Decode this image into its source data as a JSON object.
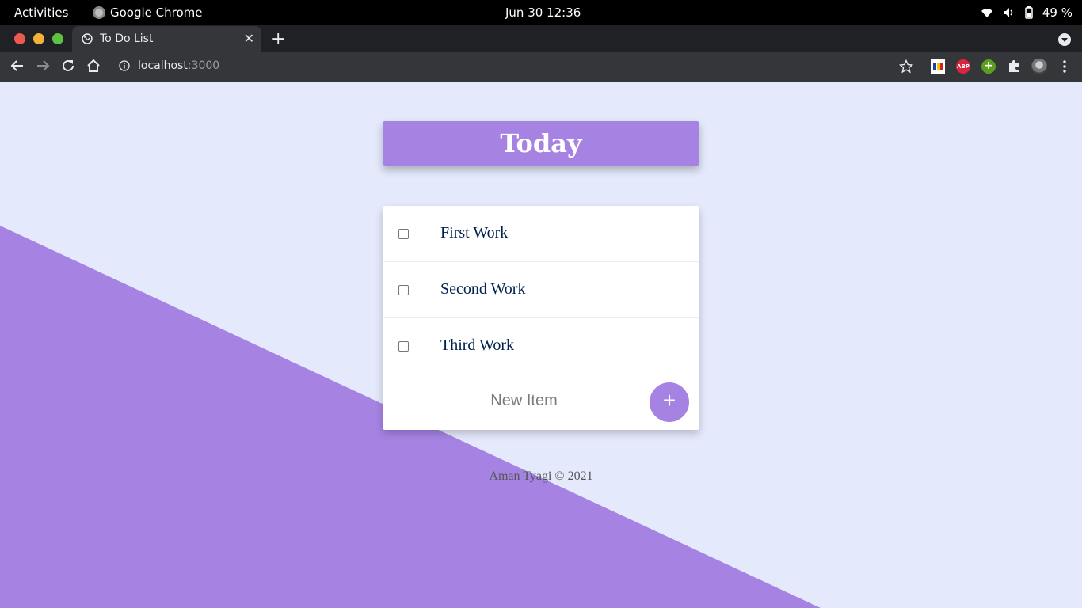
{
  "system_bar": {
    "activities": "Activities",
    "app_name": "Google Chrome",
    "clock": "Jun 30  12:36",
    "battery": "49 %"
  },
  "browser": {
    "tab_title": "To Do List",
    "url_host": "localhost",
    "url_port": ":3000",
    "new_tab_symbol": "+",
    "tab_close_symbol": "✕",
    "extension_abp": "ABP",
    "extension_green_symbol": "+"
  },
  "app": {
    "heading": "Today",
    "items": [
      {
        "label": "First Work",
        "checked": false
      },
      {
        "label": "Second Work",
        "checked": false
      },
      {
        "label": "Third Work",
        "checked": false
      }
    ],
    "new_item_placeholder": "New Item",
    "add_button": "+",
    "footer": "Aman Tyagi © 2021"
  },
  "colors": {
    "accent": "#a683e3",
    "page_bg": "#e4e9fb",
    "item_text": "#00214d"
  }
}
